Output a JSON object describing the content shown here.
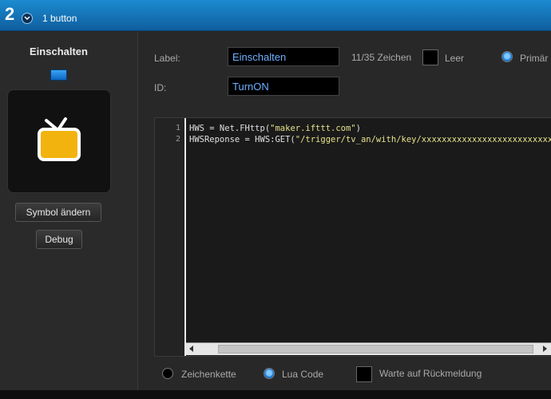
{
  "header": {
    "number": "2",
    "title": "1 button"
  },
  "left": {
    "title": "Einschalten",
    "icon": "tv-icon",
    "symbol_button": "Symbol ändern",
    "debug_button": "Debug"
  },
  "form": {
    "label_caption": "Label:",
    "label_value": "Einschalten",
    "char_count": "11/35 Zeichen",
    "empty_label": "Leer",
    "primary_label": "Primär",
    "id_caption": "ID:",
    "id_value": "TurnON"
  },
  "editor": {
    "lines": [
      {
        "number": "1",
        "code": "HWS = Net.FHttp(",
        "string": "\"maker.ifttt.com\"",
        "tail": ")"
      },
      {
        "number": "2",
        "code": "HWSReponse = HWS:GET(",
        "string": "\"/trigger/tv_an/with/key/xxxxxxxxxxxxxxxxxxxxxxxxxx",
        "tail": ""
      }
    ]
  },
  "options": {
    "string_label": "Zeichenkette",
    "lua_label": "Lua Code",
    "wait_label": "Warte auf Rückmeldung",
    "selected": "Lua Code"
  },
  "colors": {
    "accent": "#1b8bd0",
    "icon_yellow": "#f2b30f",
    "field_text": "#6fb0ff"
  }
}
